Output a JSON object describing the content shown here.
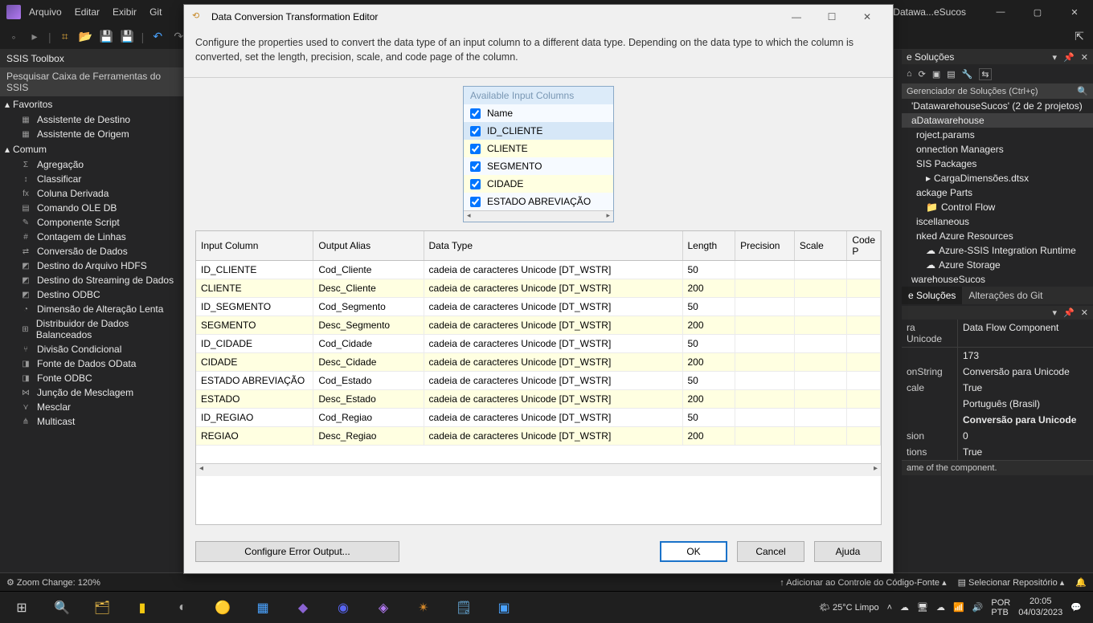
{
  "title": {
    "project": "Datawa...eSucos"
  },
  "menu": [
    "Arquivo",
    "Editar",
    "Exibir",
    "Git"
  ],
  "toolbox": {
    "header": "SSIS Toolbox",
    "search": "Pesquisar Caixa de Ferramentas do SSIS",
    "favorites": "Favoritos",
    "fav_items": [
      "Assistente de Destino",
      "Assistente de Origem"
    ],
    "common": "Comum",
    "items": [
      "Agregação",
      "Classificar",
      "Coluna Derivada",
      "Comando OLE DB",
      "Componente Script",
      "Contagem de Linhas",
      "Conversão de Dados",
      "Destino do Arquivo HDFS",
      "Destino do Streaming de Dados",
      "Destino ODBC",
      "Dimensão de Alteração Lenta",
      "Distribuidor de Dados Balanceados",
      "Divisão Condicional",
      "Fonte de Dados OData",
      "Fonte ODBC",
      "Junção de Mesclagem",
      "Mesclar",
      "Multicast"
    ]
  },
  "solution": {
    "header": "e Soluções",
    "search_ph": "Gerenciador de Soluções (Ctrl+ç)",
    "root": "'DatawarehouseSucos' (2 de 2 projetos)",
    "nodes": [
      "aDatawarehouse",
      "roject.params",
      "onnection Managers",
      "SIS Packages",
      "CargaDimensões.dtsx",
      "ackage Parts",
      "Control Flow",
      "iscellaneous",
      "nked Azure Resources",
      "Azure-SSIS Integration Runtime",
      "Azure Storage",
      "warehouseSucos"
    ],
    "tabs": {
      "a": "e Soluções",
      "b": "Alterações do Git"
    },
    "prop_title1": "ra Unicode",
    "prop_title2": "Data Flow Component",
    "rows": [
      {
        "a": "",
        "b": "173"
      },
      {
        "a": "onString",
        "b": "Conversão para Unicode"
      },
      {
        "a": "cale",
        "b": "True"
      },
      {
        "a": "",
        "b": "Português (Brasil)"
      },
      {
        "a": "",
        "b": "Conversão para Unicode"
      },
      {
        "a": "sion",
        "b": "0"
      },
      {
        "a": "tions",
        "b": "True"
      }
    ],
    "desc": "ame of the component."
  },
  "status": {
    "left": "Zoom Change: 120%",
    "r1": "Adicionar ao Controle do Código-Fonte",
    "r2": "Selecionar Repositório"
  },
  "taskbar": {
    "weather": "25°C  Limpo",
    "lang1": "POR",
    "lang2": "PTB",
    "time": "20:05",
    "date": "04/03/2023"
  },
  "dialog": {
    "title": "Data Conversion Transformation Editor",
    "intro": "Configure the properties used to convert the data type of an input column to a different data type. Depending on the data type to which the column is converted, set the length, precision, scale, and code page of the column.",
    "avail_caption": "Available Input Columns",
    "avail": [
      "Name",
      "ID_CLIENTE",
      "CLIENTE",
      "SEGMENTO",
      "CIDADE",
      "ESTADO ABREVIAÇÃO"
    ],
    "headers": {
      "c0": "Input Column",
      "c1": "Output Alias",
      "c2": "Data Type",
      "c3": "Length",
      "c4": "Precision",
      "c5": "Scale",
      "c6": "Code P"
    },
    "rows": [
      {
        "c0": "ID_CLIENTE",
        "c1": "Cod_Cliente",
        "c2": "cadeia de caracteres Unicode [DT_WSTR]",
        "c3": "50"
      },
      {
        "c0": "CLIENTE",
        "c1": "Desc_Cliente",
        "c2": "cadeia de caracteres Unicode [DT_WSTR]",
        "c3": "200"
      },
      {
        "c0": "ID_SEGMENTO",
        "c1": "Cod_Segmento",
        "c2": "cadeia de caracteres Unicode [DT_WSTR]",
        "c3": "50"
      },
      {
        "c0": "SEGMENTO",
        "c1": "Desc_Segmento",
        "c2": "cadeia de caracteres Unicode [DT_WSTR]",
        "c3": "200"
      },
      {
        "c0": "ID_CIDADE",
        "c1": "Cod_Cidade",
        "c2": "cadeia de caracteres Unicode [DT_WSTR]",
        "c3": "50"
      },
      {
        "c0": "CIDADE",
        "c1": "Desc_Cidade",
        "c2": "cadeia de caracteres Unicode [DT_WSTR]",
        "c3": "200"
      },
      {
        "c0": "ESTADO ABREVIAÇÃO",
        "c1": "Cod_Estado",
        "c2": "cadeia de caracteres Unicode [DT_WSTR]",
        "c3": "50"
      },
      {
        "c0": "ESTADO",
        "c1": "Desc_Estado",
        "c2": "cadeia de caracteres Unicode [DT_WSTR]",
        "c3": "200"
      },
      {
        "c0": "ID_REGIAO",
        "c1": "Cod_Regiao",
        "c2": "cadeia de caracteres Unicode [DT_WSTR]",
        "c3": "50"
      },
      {
        "c0": "REGIAO",
        "c1": "Desc_Regiao",
        "c2": "cadeia de caracteres Unicode [DT_WSTR]",
        "c3": "200"
      }
    ],
    "btn_err": "Configure Error Output...",
    "btn_ok": "OK",
    "btn_cancel": "Cancel",
    "btn_help": "Ajuda"
  }
}
